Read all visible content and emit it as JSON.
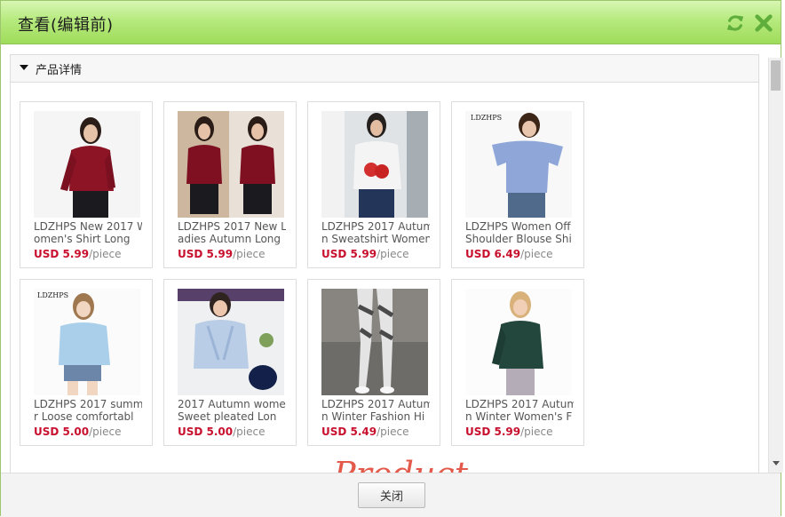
{
  "window": {
    "title": "查看(编辑前)"
  },
  "panel": {
    "title": "产品详情"
  },
  "products": [
    {
      "name": "LDZHPS New 2017 Women's Shirt Long",
      "price": "USD 5.99",
      "unit": "/piece"
    },
    {
      "name": "LDZHPS 2017 New Ladies Autumn Long",
      "price": "USD 5.99",
      "unit": "/piece"
    },
    {
      "name": "LDZHPS 2017 Autumn Sweatshirt Women",
      "price": "USD 5.99",
      "unit": "/piece"
    },
    {
      "name": "LDZHPS Women Off Shoulder Blouse Shi",
      "price": "USD 6.49",
      "unit": "/piece"
    },
    {
      "name": "LDZHPS 2017 summer Loose comfortabl",
      "price": "USD 5.00",
      "unit": "/piece"
    },
    {
      "name": "2017 Autumn women Sweet pleated Lon",
      "price": "USD 5.00",
      "unit": "/piece"
    },
    {
      "name": "LDZHPS 2017 Autumn Winter Fashion Hi",
      "price": "USD 5.49",
      "unit": "/piece"
    },
    {
      "name": "LDZHPS 2017 Autumn Winter Women's F",
      "price": "USD 5.99",
      "unit": "/piece"
    }
  ],
  "watermark": "Product Show",
  "footer": {
    "close_label": "关闭"
  },
  "colors": {
    "titlebar": "#b6ea7e",
    "price": "#c8102e",
    "icon": "#5fae3b"
  }
}
